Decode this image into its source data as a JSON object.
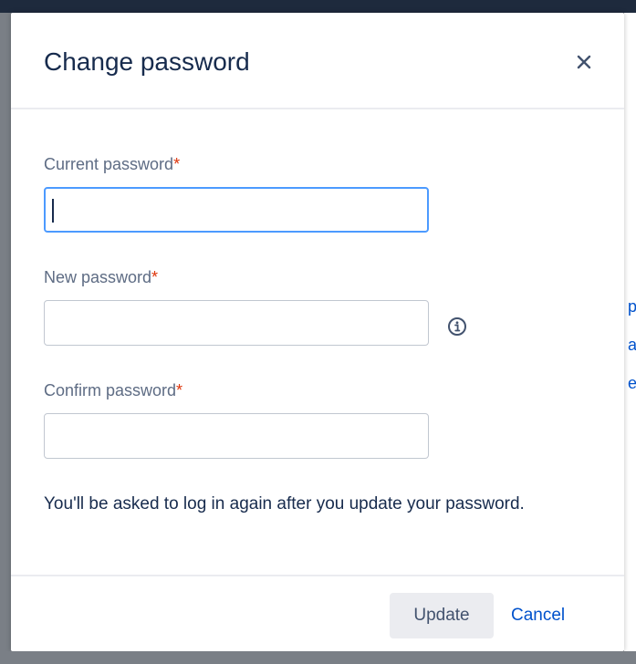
{
  "dialog": {
    "title": "Change password",
    "close_icon": "close-icon"
  },
  "fields": {
    "current": {
      "label": "Current password",
      "required_mark": "*",
      "value": ""
    },
    "new": {
      "label": "New password",
      "required_mark": "*",
      "value": "",
      "info_icon": "info-icon"
    },
    "confirm": {
      "label": "Confirm password",
      "required_mark": "*",
      "value": ""
    }
  },
  "note": "You'll be asked to log in again after you update your password.",
  "footer": {
    "update_label": "Update",
    "cancel_label": "Cancel"
  },
  "background_peek": {
    "line1": "p",
    "line2": "a",
    "line3": "e"
  },
  "colors": {
    "accent": "#0052cc",
    "required": "#de350b",
    "focus_border": "#4c9aff",
    "label": "#5e6c84",
    "text": "#172b4d"
  }
}
